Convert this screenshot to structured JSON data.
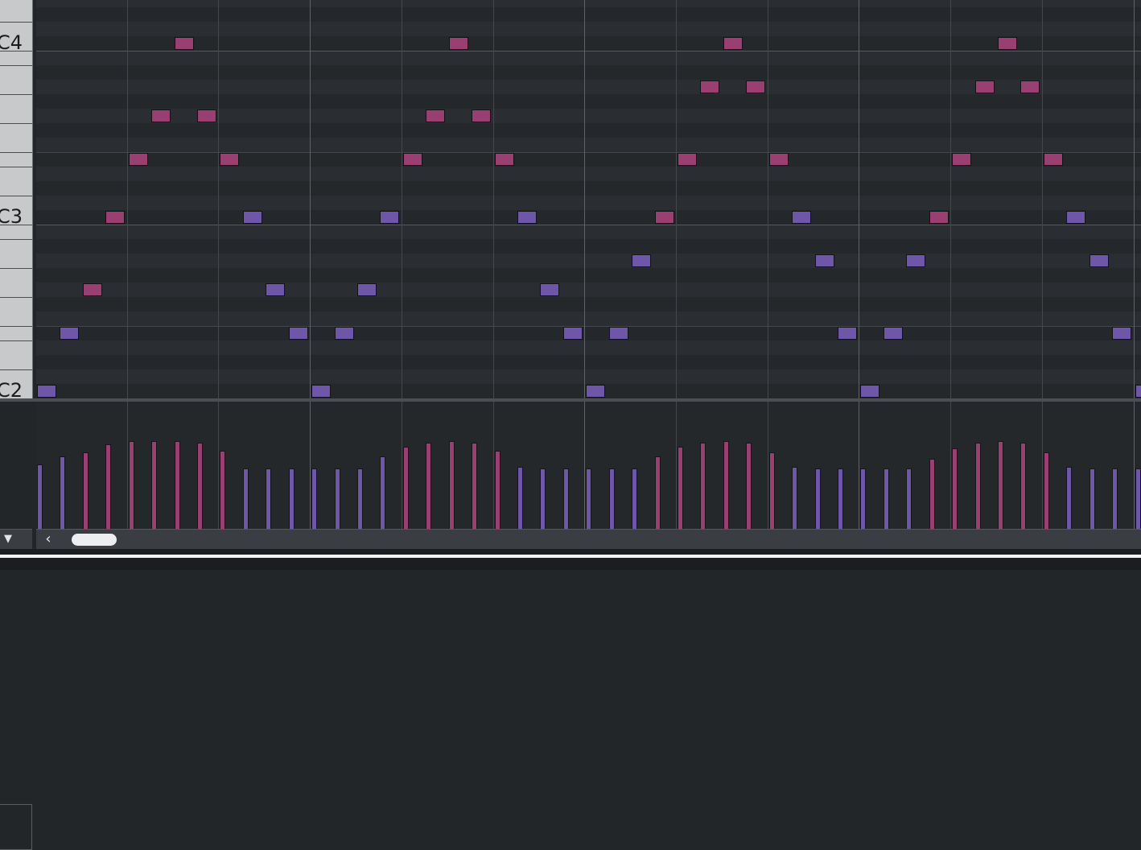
{
  "keyboard": {
    "labels": [
      "C4",
      "C3",
      "C2"
    ]
  },
  "colors": {
    "background": "#25282b",
    "lane_alt": "#2a2d31",
    "bar_line": "#5f6368",
    "beat_line": "#44484d",
    "octave_line": "#565a5f",
    "note_pink": "#9a3f72",
    "note_purple": "#6e56a8"
  },
  "controls": {
    "collapse_glyph": "▼",
    "scroll_left_glyph": "‹"
  },
  "notes": [
    {
      "beat": 0,
      "pitch": "C2",
      "color": "purple"
    },
    {
      "beat": 1,
      "pitch": "E2",
      "color": "purple"
    },
    {
      "beat": 2,
      "pitch": "G2",
      "color": "pink"
    },
    {
      "beat": 3,
      "pitch": "C3",
      "color": "pink"
    },
    {
      "beat": 4,
      "pitch": "E3",
      "color": "pink"
    },
    {
      "beat": 5,
      "pitch": "G3",
      "color": "pink"
    },
    {
      "beat": 6,
      "pitch": "C4",
      "color": "pink"
    },
    {
      "beat": 7,
      "pitch": "G3",
      "color": "pink"
    },
    {
      "beat": 8,
      "pitch": "E3",
      "color": "pink"
    },
    {
      "beat": 9,
      "pitch": "C3",
      "color": "purple"
    },
    {
      "beat": 10,
      "pitch": "G2",
      "color": "purple"
    },
    {
      "beat": 11,
      "pitch": "E2",
      "color": "purple"
    },
    {
      "beat": 12,
      "pitch": "C2",
      "color": "purple"
    },
    {
      "beat": 13,
      "pitch": "E2",
      "color": "purple"
    },
    {
      "beat": 14,
      "pitch": "G2",
      "color": "purple"
    },
    {
      "beat": 15,
      "pitch": "C3",
      "color": "purple"
    },
    {
      "beat": 16,
      "pitch": "E3",
      "color": "pink"
    },
    {
      "beat": 17,
      "pitch": "G3",
      "color": "pink"
    },
    {
      "beat": 18,
      "pitch": "C4",
      "color": "pink"
    },
    {
      "beat": 19,
      "pitch": "G3",
      "color": "pink"
    },
    {
      "beat": 20,
      "pitch": "E3",
      "color": "pink"
    },
    {
      "beat": 21,
      "pitch": "C3",
      "color": "purple"
    },
    {
      "beat": 22,
      "pitch": "G2",
      "color": "purple"
    },
    {
      "beat": 23,
      "pitch": "E2",
      "color": "purple"
    },
    {
      "beat": 24,
      "pitch": "C2",
      "color": "purple"
    },
    {
      "beat": 25,
      "pitch": "E2",
      "color": "purple"
    },
    {
      "beat": 26,
      "pitch": "A2",
      "color": "purple"
    },
    {
      "beat": 27,
      "pitch": "C3",
      "color": "pink"
    },
    {
      "beat": 28,
      "pitch": "E3",
      "color": "pink"
    },
    {
      "beat": 29,
      "pitch": "A3",
      "color": "pink"
    },
    {
      "beat": 30,
      "pitch": "C4",
      "color": "pink"
    },
    {
      "beat": 31,
      "pitch": "A3",
      "color": "pink"
    },
    {
      "beat": 32,
      "pitch": "E3",
      "color": "pink"
    },
    {
      "beat": 33,
      "pitch": "C3",
      "color": "purple"
    },
    {
      "beat": 34,
      "pitch": "A2",
      "color": "purple"
    },
    {
      "beat": 35,
      "pitch": "E2",
      "color": "purple"
    },
    {
      "beat": 36,
      "pitch": "C2",
      "color": "purple"
    },
    {
      "beat": 37,
      "pitch": "E2",
      "color": "purple"
    },
    {
      "beat": 38,
      "pitch": "A2",
      "color": "purple"
    },
    {
      "beat": 39,
      "pitch": "C3",
      "color": "pink"
    },
    {
      "beat": 40,
      "pitch": "E3",
      "color": "pink"
    },
    {
      "beat": 41,
      "pitch": "A3",
      "color": "pink"
    },
    {
      "beat": 42,
      "pitch": "C4",
      "color": "pink"
    },
    {
      "beat": 43,
      "pitch": "A3",
      "color": "pink"
    },
    {
      "beat": 44,
      "pitch": "E3",
      "color": "pink"
    },
    {
      "beat": 45,
      "pitch": "C3",
      "color": "purple"
    },
    {
      "beat": 46,
      "pitch": "A2",
      "color": "purple"
    },
    {
      "beat": 47,
      "pitch": "E2",
      "color": "purple"
    },
    {
      "beat": 48,
      "pitch": "C2",
      "color": "purple"
    }
  ],
  "velocities": [
    {
      "value": 64,
      "color": "purple"
    },
    {
      "value": 72,
      "color": "purple"
    },
    {
      "value": 76,
      "color": "pink"
    },
    {
      "value": 84,
      "color": "pink"
    },
    {
      "value": 88,
      "color": "pink"
    },
    {
      "value": 88,
      "color": "pink"
    },
    {
      "value": 88,
      "color": "pink"
    },
    {
      "value": 86,
      "color": "pink"
    },
    {
      "value": 78,
      "color": "pink"
    },
    {
      "value": 60,
      "color": "purple"
    },
    {
      "value": 60,
      "color": "purple"
    },
    {
      "value": 60,
      "color": "purple"
    },
    {
      "value": 60,
      "color": "purple"
    },
    {
      "value": 60,
      "color": "purple"
    },
    {
      "value": 60,
      "color": "purple"
    },
    {
      "value": 72,
      "color": "purple"
    },
    {
      "value": 82,
      "color": "pink"
    },
    {
      "value": 86,
      "color": "pink"
    },
    {
      "value": 88,
      "color": "pink"
    },
    {
      "value": 86,
      "color": "pink"
    },
    {
      "value": 78,
      "color": "pink"
    },
    {
      "value": 62,
      "color": "purple"
    },
    {
      "value": 60,
      "color": "purple"
    },
    {
      "value": 60,
      "color": "purple"
    },
    {
      "value": 60,
      "color": "purple"
    },
    {
      "value": 60,
      "color": "purple"
    },
    {
      "value": 60,
      "color": "purple"
    },
    {
      "value": 72,
      "color": "pink"
    },
    {
      "value": 82,
      "color": "pink"
    },
    {
      "value": 86,
      "color": "pink"
    },
    {
      "value": 88,
      "color": "pink"
    },
    {
      "value": 86,
      "color": "pink"
    },
    {
      "value": 76,
      "color": "pink"
    },
    {
      "value": 62,
      "color": "purple"
    },
    {
      "value": 60,
      "color": "purple"
    },
    {
      "value": 60,
      "color": "purple"
    },
    {
      "value": 60,
      "color": "purple"
    },
    {
      "value": 60,
      "color": "purple"
    },
    {
      "value": 60,
      "color": "purple"
    },
    {
      "value": 70,
      "color": "pink"
    },
    {
      "value": 80,
      "color": "pink"
    },
    {
      "value": 86,
      "color": "pink"
    },
    {
      "value": 88,
      "color": "pink"
    },
    {
      "value": 86,
      "color": "pink"
    },
    {
      "value": 76,
      "color": "pink"
    },
    {
      "value": 62,
      "color": "purple"
    },
    {
      "value": 60,
      "color": "purple"
    },
    {
      "value": 60,
      "color": "purple"
    },
    {
      "value": 60,
      "color": "purple"
    }
  ],
  "scrollbar": {
    "position": 0.03
  }
}
